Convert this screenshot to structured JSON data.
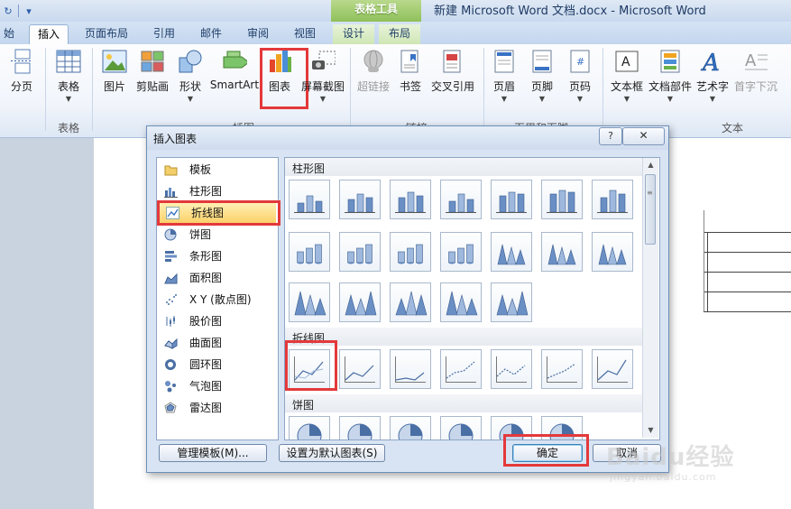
{
  "window": {
    "title": "新建 Microsoft Word 文档.docx - Microsoft Word",
    "context_tab_group": "表格工具"
  },
  "tabs": [
    {
      "label": "开始",
      "visible_text": "始"
    },
    {
      "label": "插入"
    },
    {
      "label": "页面布局"
    },
    {
      "label": "引用"
    },
    {
      "label": "邮件"
    },
    {
      "label": "审阅"
    },
    {
      "label": "视图"
    },
    {
      "label": "设计"
    },
    {
      "label": "布局"
    }
  ],
  "ribbon": {
    "buttons": {
      "page_break": "分页",
      "table": "表格",
      "picture": "图片",
      "clipart": "剪贴画",
      "shapes": "形状",
      "smartart": "SmartArt",
      "chart": "图表",
      "screenshot": "屏幕截图",
      "hyperlink": "超链接",
      "bookmark": "书签",
      "cross_reference": "交叉引用",
      "header": "页眉",
      "footer": "页脚",
      "page_number": "页码",
      "textbox": "文本框",
      "quick_parts": "文档部件",
      "wordart": "艺术字",
      "drop_cap": "首字下沉"
    },
    "groups": {
      "tables": "表格",
      "illustrations": "插图",
      "links": "链接",
      "header_footer": "页眉和页脚",
      "text": "文本"
    }
  },
  "dialog": {
    "title": "插入图表",
    "help": "?",
    "close": "✕",
    "chart_types": [
      {
        "label": "模板",
        "icon": "folder-icon"
      },
      {
        "label": "柱形图",
        "icon": "column-chart-icon"
      },
      {
        "label": "折线图",
        "icon": "line-chart-icon",
        "selected": true
      },
      {
        "label": "饼图",
        "icon": "pie-chart-icon"
      },
      {
        "label": "条形图",
        "icon": "bar-chart-icon"
      },
      {
        "label": "面积图",
        "icon": "area-chart-icon"
      },
      {
        "label": "X Y (散点图)",
        "icon": "scatter-chart-icon"
      },
      {
        "label": "股价图",
        "icon": "stock-chart-icon"
      },
      {
        "label": "曲面图",
        "icon": "surface-chart-icon"
      },
      {
        "label": "圆环图",
        "icon": "doughnut-chart-icon"
      },
      {
        "label": "气泡图",
        "icon": "bubble-chart-icon"
      },
      {
        "label": "雷达图",
        "icon": "radar-chart-icon"
      }
    ],
    "gallery_sections": {
      "column": "柱形图",
      "line": "折线图",
      "pie": "饼图"
    },
    "buttons": {
      "manage_templates": "管理模板(M)...",
      "set_default": "设置为默认图表(S)",
      "ok": "确定",
      "cancel": "取消"
    }
  },
  "watermark": {
    "text": "Baidu经验",
    "url": "jingyan.baidu.com"
  },
  "colors": {
    "highlight_red": "#e3393b",
    "selection_orange": "#fcd16a",
    "context_green": "#8fc05a"
  }
}
